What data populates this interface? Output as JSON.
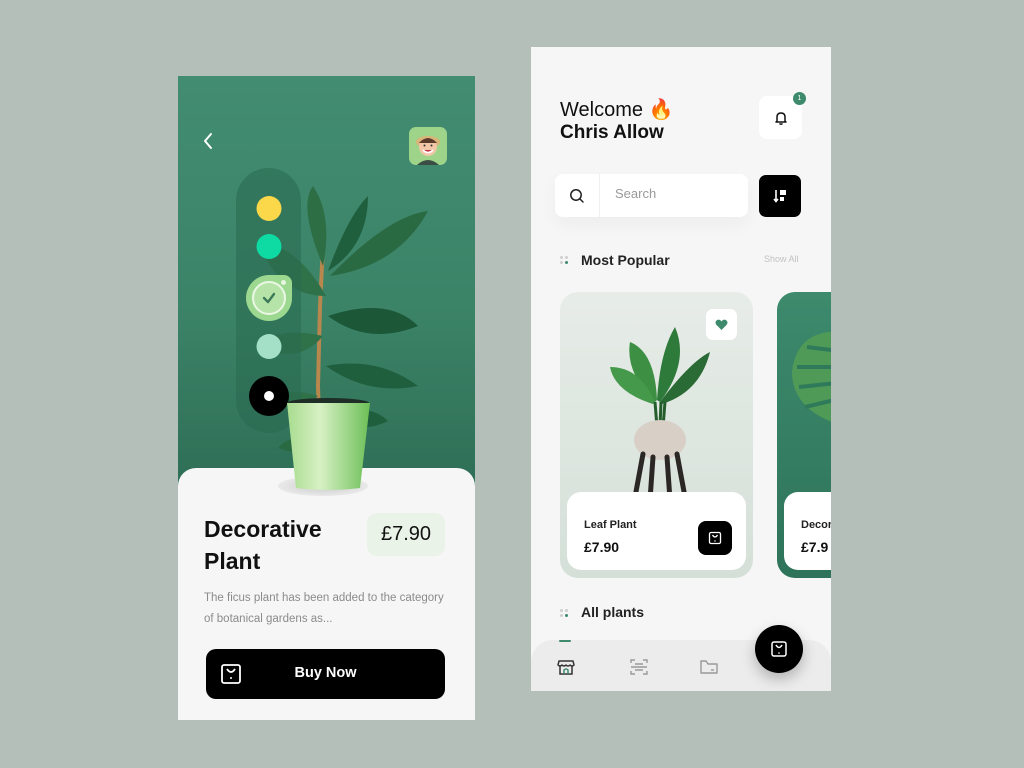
{
  "detail_screen": {
    "back_icon": "chevron-left-icon",
    "avatar_alt": "user-avatar",
    "color_options": [
      {
        "name": "yellow",
        "color": "#fbd84a",
        "selected": false
      },
      {
        "name": "mint",
        "color": "#0edba4",
        "selected": false
      },
      {
        "name": "light-green",
        "color": "#9cd88f",
        "selected": true
      },
      {
        "name": "pale-teal",
        "color": "#a3e0c7",
        "selected": false
      },
      {
        "name": "black",
        "color": "#000000",
        "selected": false
      }
    ],
    "product_title_line1": "Decorative",
    "product_title_line2": "Plant",
    "price": "£7.90",
    "description": "The ficus plant has been added to the category of botanical gardens as...",
    "buy_button_label": "Buy Now",
    "hero_color": "#3f8a6e"
  },
  "home_screen": {
    "greeting": "Welcome 🔥",
    "user_name": "Chris Allow",
    "notification_count": "1",
    "search": {
      "placeholder": "Search",
      "value": ""
    },
    "sections": {
      "popular_title": "Most Popular",
      "show_all_label": "Show All",
      "all_plants_title": "All plants"
    },
    "popular_items": [
      {
        "name": "Leaf Plant",
        "price": "£7.90",
        "favorited": true
      },
      {
        "name": "Decor",
        "price": "£7.9"
      }
    ],
    "bottom_nav": [
      {
        "name": "store",
        "icon": "store-icon",
        "active": true
      },
      {
        "name": "scan",
        "icon": "scan-icon",
        "active": false
      },
      {
        "name": "folder",
        "icon": "folder-icon",
        "active": false
      }
    ],
    "accent_color": "#3d8a6d"
  }
}
